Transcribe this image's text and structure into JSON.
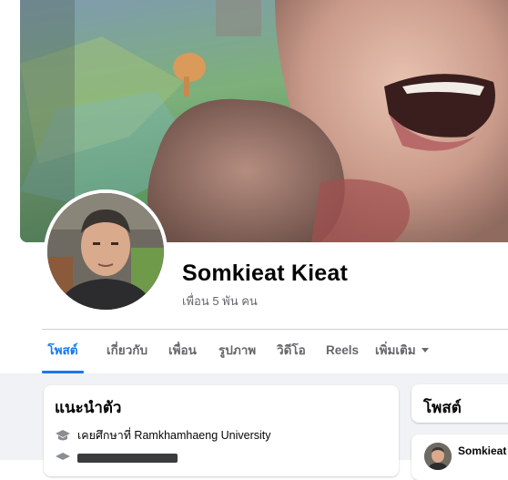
{
  "profile": {
    "name": "Somkieat Kieat",
    "friends": "เพื่อน 5 พัน คน"
  },
  "tabs": [
    {
      "label": "โพสต์",
      "active": true
    },
    {
      "label": "เกี่ยวกับ",
      "active": false
    },
    {
      "label": "เพื่อน",
      "active": false
    },
    {
      "label": "รูปภาพ",
      "active": false
    },
    {
      "label": "วิดีโอ",
      "active": false
    },
    {
      "label": "Reels",
      "active": false
    },
    {
      "label": "เพิ่มเติม",
      "active": false
    }
  ],
  "intro": {
    "title": "แนะนำตัว",
    "education": "เคยศึกษาที่ Ramkhamhaeng University"
  },
  "posts": {
    "title": "โพสต์",
    "author": "Somkieat"
  },
  "colors": {
    "accent": "#1877f2",
    "secondary_text": "#65676b",
    "background": "#f0f2f5"
  }
}
